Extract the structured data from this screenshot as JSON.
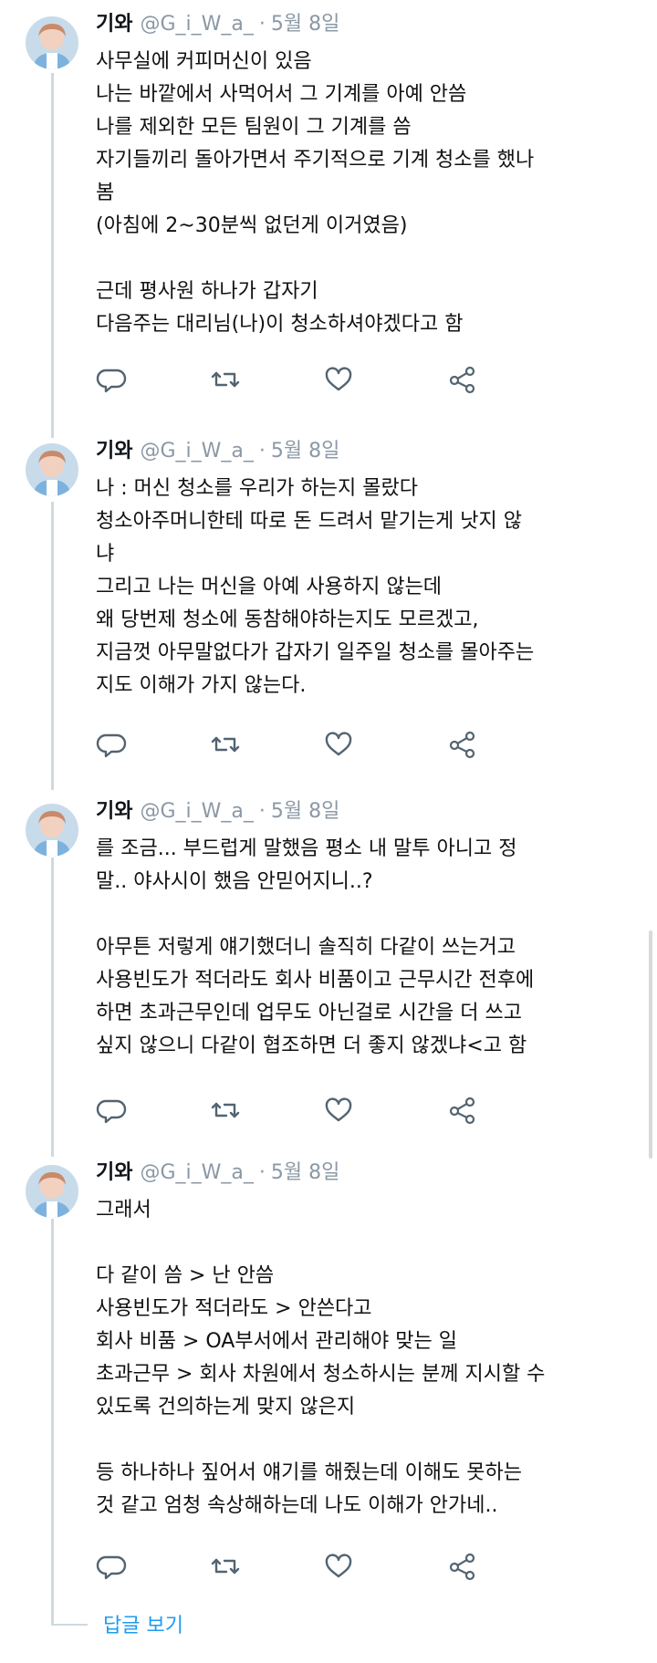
{
  "author": {
    "name": "기와",
    "handle": "@G_i_W_a_",
    "separator": "·"
  },
  "tweets": [
    {
      "date": "5월 8일",
      "lines": [
        "사무실에 커피머신이 있음",
        "나는 바깥에서 사먹어서 그 기계를 아예 안씀",
        "나를 제외한 모든 팀원이 그 기계를 씀",
        "자기들끼리 돌아가면서 주기적으로 기계 청소를 했나",
        "봄",
        "(아침에 2~30분씩 없던게 이거였음)",
        "",
        "근데 평사원 하나가 갑자기",
        "다음주는 대리님(나)이 청소하셔야겠다고 함"
      ]
    },
    {
      "date": "5월 8일",
      "lines": [
        "나 : 머신 청소를 우리가 하는지 몰랐다",
        "청소아주머니한테 따로 돈 드려서 맡기는게 낫지 않",
        "냐",
        "그리고 나는 머신을 아예 사용하지 않는데",
        "왜 당번제 청소에 동참해야하는지도 모르겠고,",
        "지금껏 아무말없다가 갑자기 일주일 청소를 몰아주는",
        "지도 이해가 가지 않는다."
      ]
    },
    {
      "date": "5월 8일",
      "lines": [
        "를 조금... 부드럽게 말했음 평소 내 말투 아니고 정",
        "말.. 야사시이 했음 안믿어지니..?",
        "",
        "아무튼 저렇게 얘기했더니 솔직히 다같이 쓰는거고",
        "사용빈도가 적더라도 회사 비품이고 근무시간 전후에",
        "하면 초과근무인데 업무도 아닌걸로 시간을 더 쓰고",
        "싶지 않으니 다같이 협조하면 더 좋지 않겠냐<고 함"
      ]
    },
    {
      "date": "5월 8일",
      "lines": [
        "그래서",
        "",
        "다 같이 씀 > 난 안씀",
        "사용빈도가 적더라도 > 안쓴다고",
        "회사 비품 > OA부서에서 관리해야 맞는 일",
        "초과근무 > 회사 차원에서 청소하시는 분께 지시할 수",
        "있도록 건의하는게 맞지 않은지",
        "",
        "등 하나하나 짚어서 얘기를 해줬는데 이해도 못하는",
        "것 같고 엄청 속상해하는데 나도 이해가 안가네.."
      ]
    }
  ],
  "show_replies_label": "답글 보기",
  "icons": {
    "reply": "reply-icon",
    "retweet": "retweet-icon",
    "like": "heart-icon",
    "share": "share-icon"
  },
  "colors": {
    "text": "#111111",
    "muted": "#8b98a5",
    "icon": "#536471",
    "link": "#1d9bf0",
    "thread_line": "#cfd9de"
  }
}
